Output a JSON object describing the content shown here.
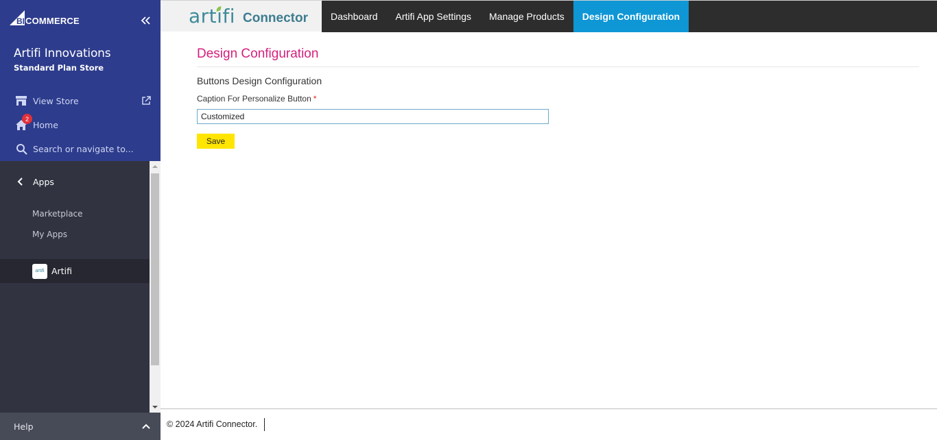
{
  "sidebar": {
    "brand": {
      "big": "BIG",
      "commerce": "COMMERCE"
    },
    "store_name": "Artifi Innovations",
    "store_plan": "Standard Plan Store",
    "links": [
      {
        "label": "View Store",
        "icon": "storefront-icon"
      },
      {
        "label": "Home",
        "icon": "home-icon",
        "badge": "2"
      },
      {
        "label": "Search or navigate to...",
        "icon": "search-icon"
      }
    ],
    "apps": {
      "heading": "Apps",
      "items": [
        "Marketplace",
        "My Apps"
      ],
      "installed": {
        "name": "Artifi",
        "logo_text": "artifi"
      }
    },
    "help": "Help"
  },
  "header": {
    "logo_text": "artifi",
    "product": "Connector",
    "nav": [
      {
        "label": "Dashboard",
        "active": false
      },
      {
        "label": "Artifi App Settings",
        "active": false
      },
      {
        "label": "Manage Products",
        "active": false
      },
      {
        "label": "Design Configuration",
        "active": true
      }
    ]
  },
  "main": {
    "title": "Design Configuration",
    "section_title": "Buttons Design Configuration",
    "field_label": "Caption For Personalize Button",
    "required_mark": "*",
    "field_value": "Customized",
    "save_label": "Save"
  },
  "footer": {
    "text": "© 2024 Artifi Connector."
  },
  "colors": {
    "sidebar_top": "#2d3c8c",
    "sidebar_bottom": "#313440",
    "nav_bg": "#2d2d2d",
    "nav_active": "#0e96d5",
    "title_pink": "#d61f7c",
    "save_yellow": "#ffe500",
    "artifi_teal": "#3e8a99"
  }
}
